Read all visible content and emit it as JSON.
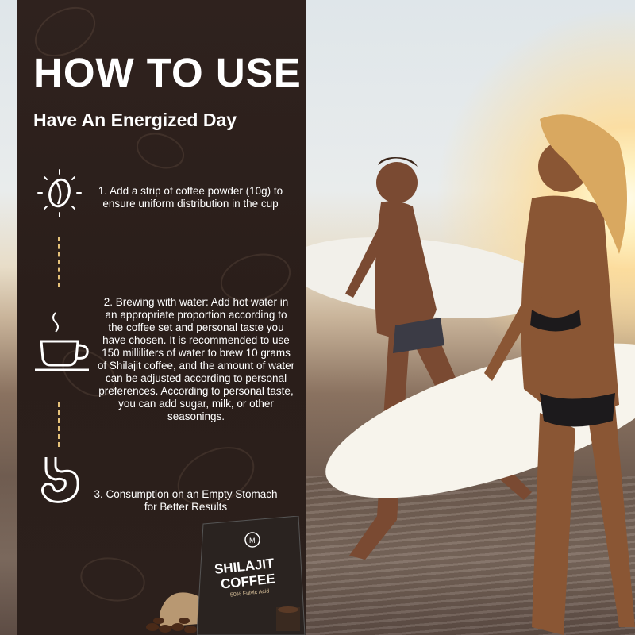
{
  "heading": {
    "title": "HOW TO USE",
    "subtitle": "Have An Energized Day"
  },
  "steps": [
    {
      "icon": "coffee-bean-icon",
      "text": "1. Add a strip of coffee powder (10g) to ensure uniform distribution in the cup"
    },
    {
      "icon": "coffee-cup-icon",
      "text": "2. Brewing with water: Add hot water in an appropriate proportion according to the coffee set and personal taste you have chosen. It is recommended to use 150 milliliters of water to brew 10 grams of Shilajit coffee, and the amount of water can be adjusted according to personal preferences. According to personal taste, you can add sugar, milk, or other seasonings."
    },
    {
      "icon": "stomach-icon",
      "text": "3. Consumption on an Empty Stomach for Better Results"
    }
  ],
  "product": {
    "name_line1": "SHILAJIT",
    "name_line2": "COFFEE",
    "tagline": "50% Fulvic Acid"
  },
  "colors": {
    "panel": "#2c201c",
    "accent_dash": "#e6c27a",
    "text": "#ffffff"
  }
}
